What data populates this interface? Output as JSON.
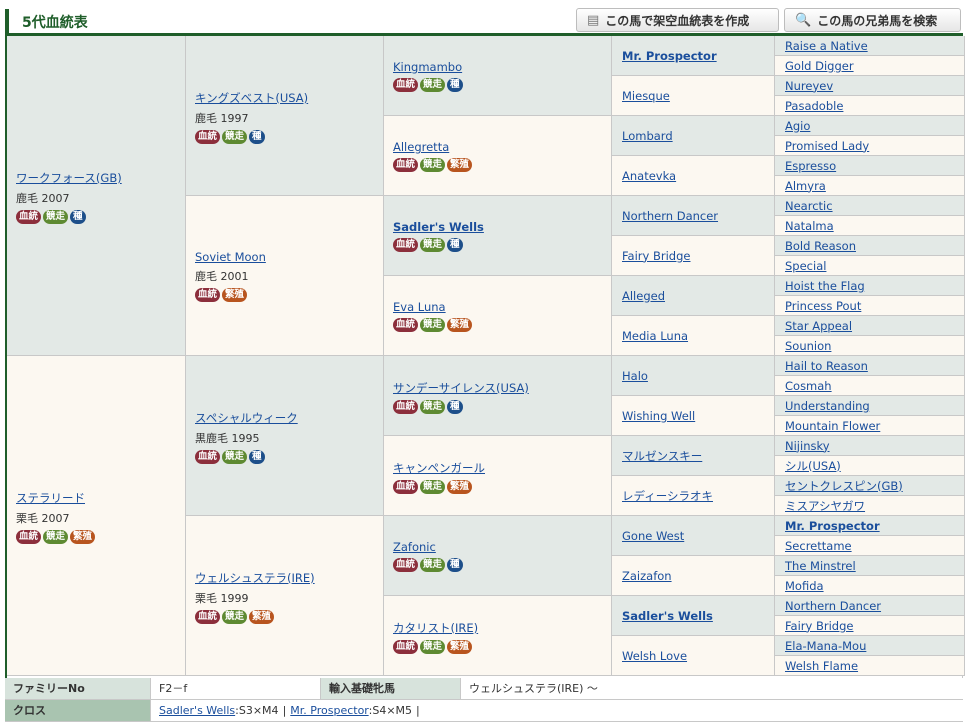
{
  "header": {
    "title": "5代血統表",
    "create_label": "この馬で架空血統表を作成",
    "search_label": "この馬の兄弟馬を検索"
  },
  "gen1": [
    {
      "name": "ワークフォース(GB)",
      "meta": "鹿毛 2007",
      "badges": [
        "血統",
        "競走",
        "種"
      ]
    },
    {
      "name": "ステラリード",
      "meta": "栗毛 2007",
      "badges": [
        "血統",
        "競走",
        "繁殖"
      ]
    }
  ],
  "gen2": [
    {
      "name": "キングズベスト(USA)",
      "meta": "鹿毛 1997",
      "badges": [
        "血統",
        "競走",
        "種"
      ]
    },
    {
      "name": "Soviet Moon",
      "meta": "鹿毛 2001",
      "badges": [
        "血統",
        "繁殖"
      ]
    },
    {
      "name": "スペシャルウィーク",
      "meta": "黒鹿毛 1995",
      "badges": [
        "血統",
        "競走",
        "種"
      ]
    },
    {
      "name": "ウェルシュステラ(IRE)",
      "meta": "栗毛 1999",
      "badges": [
        "血統",
        "競走",
        "繁殖"
      ]
    }
  ],
  "gen3": [
    {
      "name": "Kingmambo",
      "bold": false,
      "badges": [
        "血統",
        "競走",
        "種"
      ]
    },
    {
      "name": "Allegretta",
      "bold": false,
      "badges": [
        "血統",
        "競走",
        "繁殖"
      ]
    },
    {
      "name": "Sadler's Wells",
      "bold": true,
      "badges": [
        "血統",
        "競走",
        "種"
      ]
    },
    {
      "name": "Eva Luna",
      "bold": false,
      "badges": [
        "血統",
        "競走",
        "繁殖"
      ]
    },
    {
      "name": "サンデーサイレンス(USA)",
      "bold": false,
      "badges": [
        "血統",
        "競走",
        "種"
      ]
    },
    {
      "name": "キャンペンガール",
      "bold": false,
      "badges": [
        "血統",
        "競走",
        "繁殖"
      ]
    },
    {
      "name": "Zafonic",
      "bold": false,
      "badges": [
        "血統",
        "競走",
        "種"
      ]
    },
    {
      "name": "カタリスト(IRE)",
      "bold": false,
      "badges": [
        "血統",
        "競走",
        "繁殖"
      ]
    }
  ],
  "gen4": [
    {
      "name": "Mr. Prospector",
      "bold": true
    },
    {
      "name": "Miesque",
      "bold": false
    },
    {
      "name": "Lombard",
      "bold": false
    },
    {
      "name": "Anatevka",
      "bold": false
    },
    {
      "name": "Northern Dancer",
      "bold": false
    },
    {
      "name": "Fairy Bridge",
      "bold": false
    },
    {
      "name": "Alleged",
      "bold": false
    },
    {
      "name": "Media Luna",
      "bold": false
    },
    {
      "name": "Halo",
      "bold": false
    },
    {
      "name": "Wishing Well",
      "bold": false
    },
    {
      "name": "マルゼンスキー",
      "bold": false
    },
    {
      "name": "レディーシラオキ",
      "bold": false
    },
    {
      "name": "Gone West",
      "bold": false
    },
    {
      "name": "Zaizafon",
      "bold": false
    },
    {
      "name": "Sadler's Wells",
      "bold": true
    },
    {
      "name": "Welsh Love",
      "bold": false
    }
  ],
  "gen5": [
    {
      "name": "Raise a Native",
      "bold": false
    },
    {
      "name": "Gold Digger",
      "bold": false
    },
    {
      "name": "Nureyev",
      "bold": false
    },
    {
      "name": "Pasadoble",
      "bold": false
    },
    {
      "name": "Agio",
      "bold": false
    },
    {
      "name": "Promised Lady",
      "bold": false
    },
    {
      "name": "Espresso",
      "bold": false
    },
    {
      "name": "Almyra",
      "bold": false
    },
    {
      "name": "Nearctic",
      "bold": false
    },
    {
      "name": "Natalma",
      "bold": false
    },
    {
      "name": "Bold Reason",
      "bold": false
    },
    {
      "name": "Special",
      "bold": false
    },
    {
      "name": "Hoist the Flag",
      "bold": false
    },
    {
      "name": "Princess Pout",
      "bold": false
    },
    {
      "name": "Star Appeal",
      "bold": false
    },
    {
      "name": "Sounion",
      "bold": false
    },
    {
      "name": "Hail to Reason",
      "bold": false
    },
    {
      "name": "Cosmah",
      "bold": false
    },
    {
      "name": "Understanding",
      "bold": false
    },
    {
      "name": "Mountain Flower",
      "bold": false
    },
    {
      "name": "Nijinsky",
      "bold": false
    },
    {
      "name": "シル(USA)",
      "bold": false
    },
    {
      "name": "セントクレスピン(GB)",
      "bold": false
    },
    {
      "name": "ミスアシヤガワ",
      "bold": false
    },
    {
      "name": "Mr. Prospector",
      "bold": true
    },
    {
      "name": "Secrettame",
      "bold": false
    },
    {
      "name": "The Minstrel",
      "bold": false
    },
    {
      "name": "Mofida",
      "bold": false
    },
    {
      "name": "Northern Dancer",
      "bold": false
    },
    {
      "name": "Fairy Bridge",
      "bold": false
    },
    {
      "name": "Ela-Mana-Mou",
      "bold": false
    },
    {
      "name": "Welsh Flame",
      "bold": false
    }
  ],
  "footer": {
    "family_label": "ファミリーNo",
    "family_value": "F2－f",
    "import_label": "輸入基礎牝馬",
    "import_value": "ウェルシュステラ(IRE) ～",
    "cross_label": "クロス",
    "cross": [
      {
        "name": "Sadler's Wells",
        "value": ":S3×M4"
      },
      {
        "name": "Mr. Prospector",
        "value": ":S4×M5"
      }
    ],
    "cross_sep": "|"
  }
}
